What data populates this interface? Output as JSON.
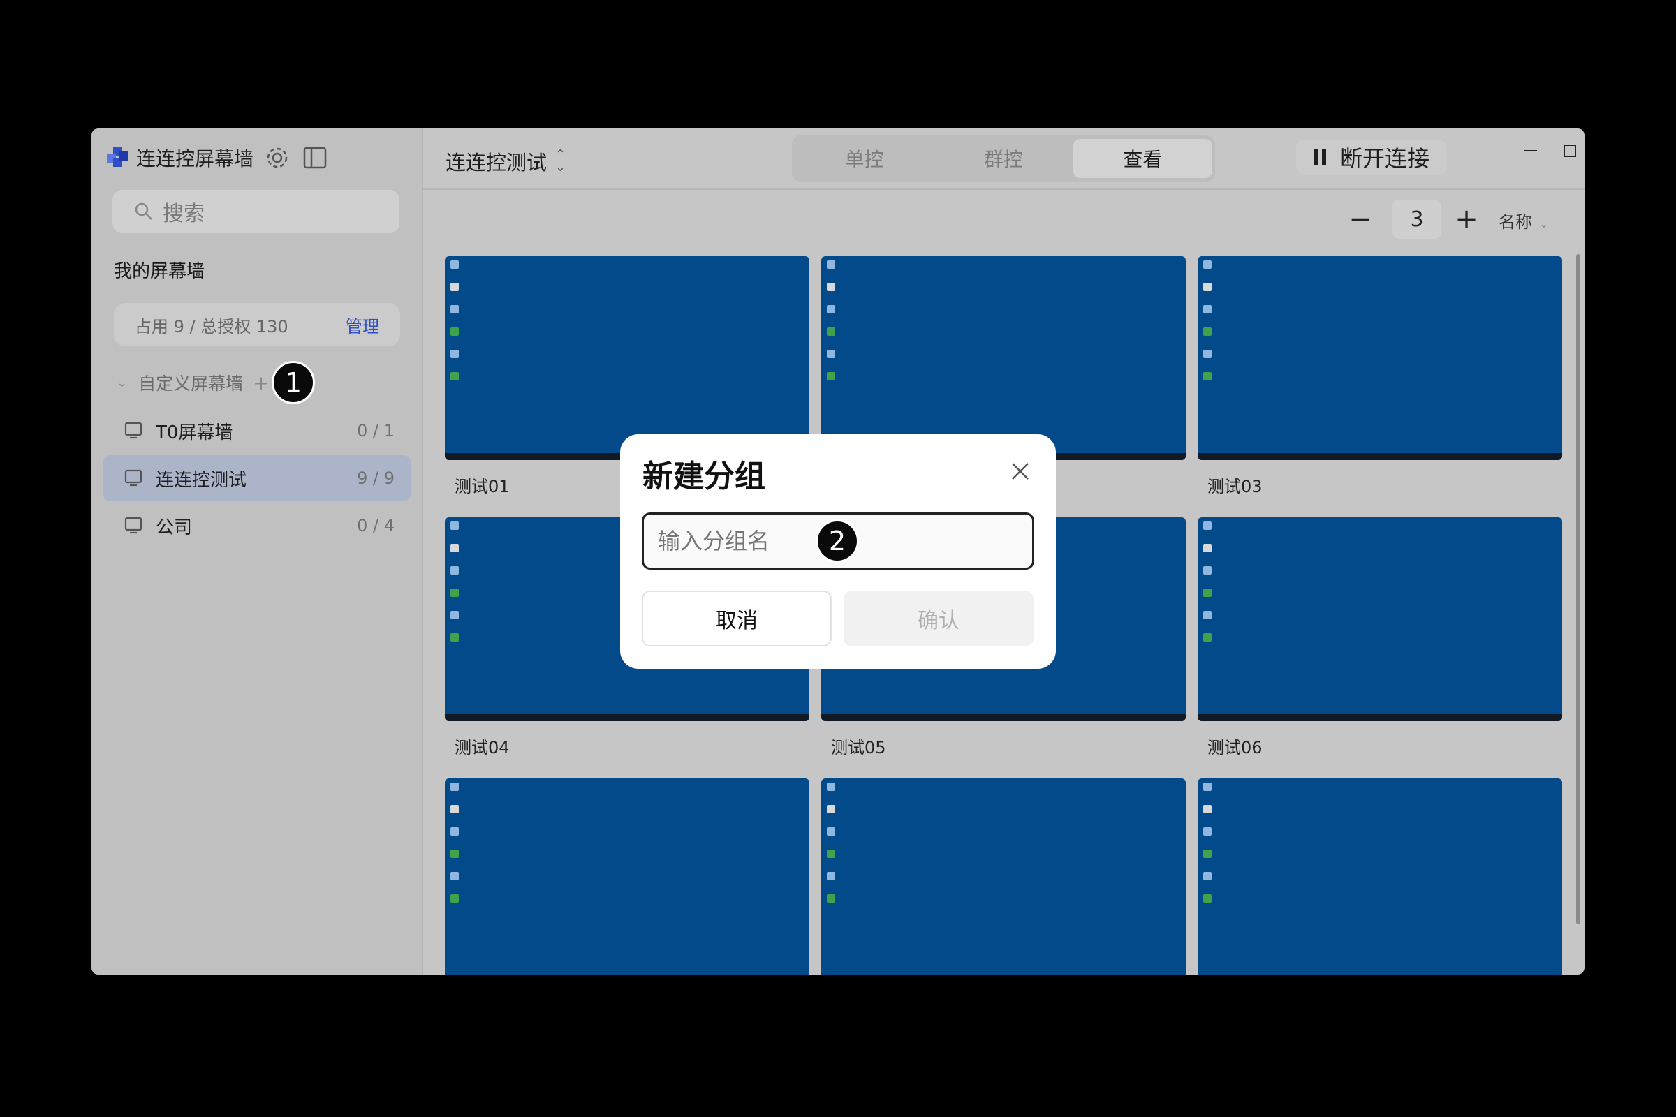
{
  "app": {
    "title": "连连控屏幕墙"
  },
  "search": {
    "placeholder": "搜索"
  },
  "sidebar": {
    "section_title": "我的屏幕墙",
    "quota_text": "占用 9 / 总授权 130",
    "manage_label": "管理",
    "custom_group_label": "自定义屏幕墙",
    "walls": [
      {
        "name": "T0屏幕墙",
        "count": "0 / 1"
      },
      {
        "name": "连连控测试",
        "count": "9 / 9"
      },
      {
        "name": "公司",
        "count": "0 / 4"
      }
    ]
  },
  "topbar": {
    "current_wall": "连连控测试",
    "tabs": [
      "单控",
      "群控",
      "查看"
    ],
    "active_tab": "查看",
    "disconnect_label": "断开连接"
  },
  "toolbar": {
    "zoom_value": "3",
    "sort_label": "名称"
  },
  "tiles": [
    "测试01",
    "",
    "测试03",
    "测试04",
    "测试05",
    "测试06",
    "",
    "",
    ""
  ],
  "modal": {
    "title": "新建分组",
    "input_placeholder": "输入分组名",
    "cancel_label": "取消",
    "confirm_label": "确认"
  },
  "annotations": [
    "1",
    "2"
  ],
  "colors": {
    "accent": "#2e4fc6",
    "desktop": "#034a8a"
  }
}
